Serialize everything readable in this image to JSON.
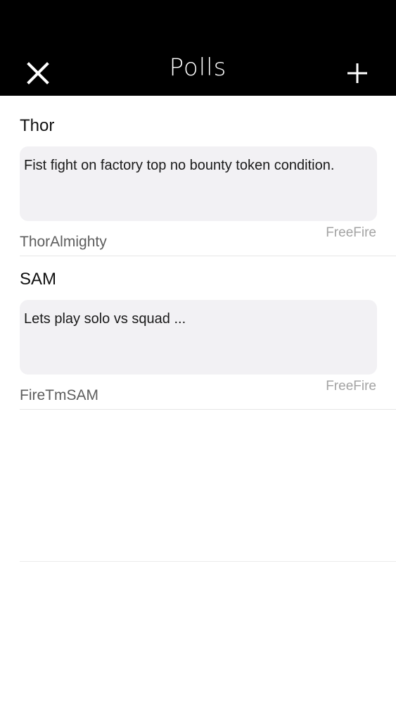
{
  "header": {
    "title": "Polls",
    "close_icon": "close-icon",
    "add_icon": "plus-icon"
  },
  "polls": [
    {
      "title": "Thor",
      "body": "Fist fight on factory top no bounty token condition.",
      "author": "ThorAlmighty",
      "game": "FreeFire"
    },
    {
      "title": "SAM",
      "body": "Lets play solo vs squad ...",
      "author": "FireTmSAM",
      "game": "FreeFire"
    }
  ],
  "colors": {
    "header_bg": "#000000",
    "bubble_bg": "#f2f1f4",
    "game_tag": "#a3a3a3",
    "author": "#5d5d5d"
  }
}
